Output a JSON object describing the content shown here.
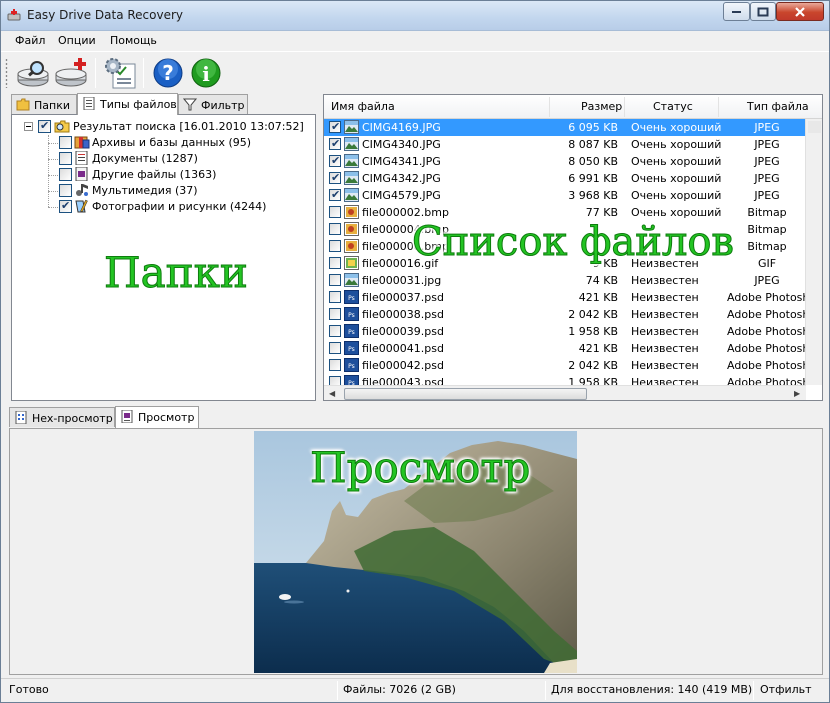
{
  "window": {
    "title": "Easy Drive Data Recovery"
  },
  "menu": [
    "Файл",
    "Опции",
    "Помощь"
  ],
  "toolbar": {
    "buttons": [
      "search-disk",
      "recover",
      "settings",
      "help",
      "info"
    ]
  },
  "left_tabs": [
    "Папки",
    "Типы файлов",
    "Фильтр"
  ],
  "tree": {
    "root": "Результат поиска [16.01.2010 13:07:52]",
    "children": [
      {
        "label": "Архивы и базы данных (95)",
        "checked": false
      },
      {
        "label": "Документы (1287)",
        "checked": false
      },
      {
        "label": "Другие файлы (1363)",
        "checked": false
      },
      {
        "label": "Мультимедия (37)",
        "checked": false
      },
      {
        "label": "Фотографии и рисунки (4244)",
        "checked": true
      }
    ]
  },
  "overlays": {
    "left": "Папки",
    "list": "Список файлов",
    "preview": "Просмотр"
  },
  "file_list": {
    "columns": [
      "Имя файла",
      "Размер",
      "Статус",
      "Тип файла"
    ],
    "rows": [
      {
        "name": "CIMG4169.JPG",
        "size": "6 095 KB",
        "status": "Очень хороший",
        "type": "JPEG",
        "checked": true,
        "selected": true,
        "icon": "jpg"
      },
      {
        "name": "CIMG4340.JPG",
        "size": "8 087 KB",
        "status": "Очень хороший",
        "type": "JPEG",
        "checked": true,
        "icon": "jpg"
      },
      {
        "name": "CIMG4341.JPG",
        "size": "8 050 KB",
        "status": "Очень хороший",
        "type": "JPEG",
        "checked": true,
        "icon": "jpg"
      },
      {
        "name": "CIMG4342.JPG",
        "size": "6 991 KB",
        "status": "Очень хороший",
        "type": "JPEG",
        "checked": true,
        "icon": "jpg"
      },
      {
        "name": "CIMG4579.JPG",
        "size": "3 968 KB",
        "status": "Очень хороший",
        "type": "JPEG",
        "checked": true,
        "icon": "jpg"
      },
      {
        "name": "file000002.bmp",
        "size": "77 KB",
        "status": "Очень хороший",
        "type": "Bitmap",
        "checked": false,
        "icon": "bmp"
      },
      {
        "name": "file000004.bmp",
        "size": "",
        "status": "",
        "type": "Bitmap",
        "checked": false,
        "icon": "bmp"
      },
      {
        "name": "file000008.bmp",
        "size": "",
        "status": "",
        "type": "Bitmap",
        "checked": false,
        "icon": "bmp"
      },
      {
        "name": "file000016.gif",
        "size": "9 KB",
        "status": "Неизвестен",
        "type": "GIF",
        "checked": false,
        "icon": "gif"
      },
      {
        "name": "file000031.jpg",
        "size": "74 KB",
        "status": "Неизвестен",
        "type": "JPEG",
        "checked": false,
        "icon": "jpg"
      },
      {
        "name": "file000037.psd",
        "size": "421 KB",
        "status": "Неизвестен",
        "type": "Adobe Photosh",
        "checked": false,
        "icon": "psd"
      },
      {
        "name": "file000038.psd",
        "size": "2 042 KB",
        "status": "Неизвестен",
        "type": "Adobe Photosh",
        "checked": false,
        "icon": "psd"
      },
      {
        "name": "file000039.psd",
        "size": "1 958 KB",
        "status": "Неизвестен",
        "type": "Adobe Photosh",
        "checked": false,
        "icon": "psd"
      },
      {
        "name": "file000041.psd",
        "size": "421 KB",
        "status": "Неизвестен",
        "type": "Adobe Photosh",
        "checked": false,
        "icon": "psd"
      },
      {
        "name": "file000042.psd",
        "size": "2 042 KB",
        "status": "Неизвестен",
        "type": "Adobe Photosh",
        "checked": false,
        "icon": "psd"
      },
      {
        "name": "file000043.psd",
        "size": "1 958 KB",
        "status": "Неизвестен",
        "type": "Adobe Photosh",
        "checked": false,
        "icon": "psd"
      }
    ]
  },
  "bottom_tabs": [
    "Hex-просмотр",
    "Просмотр"
  ],
  "status": {
    "ready": "Готово",
    "files": "Файлы: 7026 (2 GB)",
    "to_recover": "Для восстановления: 140 (419 MB)",
    "filtered": "Отфильт"
  },
  "colors": {
    "selection": "#3399ff",
    "overlay_green": "#23c423"
  }
}
